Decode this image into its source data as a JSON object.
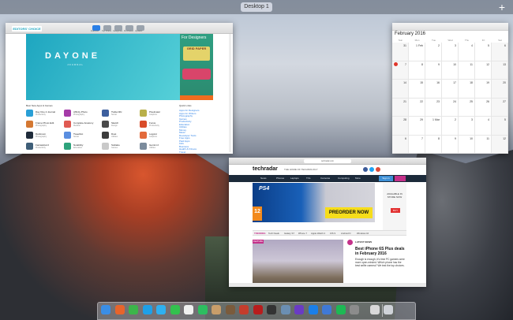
{
  "spaces_bar": {
    "desktop_label": "Desktop 1",
    "add_label": "+"
  },
  "app_store": {
    "tabs": [
      "Featured",
      "Top Charts",
      "Categories",
      "Purchased",
      "Updates"
    ],
    "hero": {
      "badge": "EDITORS' CHOICE",
      "title": "DAYONE",
      "subtitle": "JOURNAL"
    },
    "side": {
      "heading": "For Designers",
      "promo": "GRID PAPER"
    },
    "section_title": "Best New Apps & Games",
    "side_section_title": "Quick Links",
    "apps": [
      {
        "name": "Day One 2 Journal",
        "sub": "Productivity",
        "color": "#2a9fd6"
      },
      {
        "name": "Affinity Photo",
        "sub": "Photography",
        "color": "#a53ba8"
      },
      {
        "name": "Twitterrific",
        "sub": "Social",
        "color": "#3d5f9e"
      },
      {
        "name": "Pixelmator",
        "sub": "Graphics",
        "color": "#b9b04a"
      },
      {
        "name": "Frame Photo Edit",
        "sub": "Photography",
        "color": "#d47832"
      },
      {
        "name": "Complete Anatomy",
        "sub": "Medical",
        "color": "#e05a52"
      },
      {
        "name": "Sketch",
        "sub": "Design",
        "color": "#4a4a4a"
      },
      {
        "name": "Focus",
        "sub": "Productivity",
        "color": "#d94c2a"
      },
      {
        "name": "Darkroom",
        "sub": "Photography",
        "color": "#1f2b3a"
      },
      {
        "name": "Tweetbot",
        "sub": "Social",
        "color": "#5a8ee0"
      },
      {
        "name": "Duet",
        "sub": "Utilities",
        "color": "#3c3c3c"
      },
      {
        "name": "Logoist",
        "sub": "Graphics",
        "color": "#e36a3b"
      },
      {
        "name": "Fantastical 2",
        "sub": "Productivity",
        "color": "#3e5e78"
      },
      {
        "name": "Notability",
        "sub": "Education",
        "color": "#2ea37c"
      },
      {
        "name": "Solitaire",
        "sub": "Games",
        "color": "#c9c9c9"
      },
      {
        "name": "Gemini 2",
        "sub": "Utilities",
        "color": "#7b8b9c"
      }
    ],
    "paid_links": [
      "Apps for Designers",
      "Apps for Writers",
      "Photography",
      "Games",
      "Productivity",
      "Education",
      "Utilities",
      "Money",
      "Music",
      "Developer Tools",
      "Free Apps",
      "Paid Apps",
      "Kids",
      "Business",
      "Health & Fitness",
      "Travel",
      "Lifestyle",
      "Reference",
      "Weather",
      "News"
    ]
  },
  "calendar": {
    "title": "February 2016",
    "day_headers": [
      "Sun",
      "Mon",
      "Tue",
      "Wed",
      "Thu",
      "Fri",
      "Sat"
    ],
    "weeks": [
      [
        "31",
        "1 Feb",
        "2",
        "3",
        "4",
        "5",
        "6"
      ],
      [
        "7",
        "8",
        "9",
        "10",
        "11",
        "12",
        "13"
      ],
      [
        "14",
        "15",
        "16",
        "17",
        "18",
        "19",
        "20"
      ],
      [
        "21",
        "22",
        "23",
        "24",
        "25",
        "26",
        "27"
      ],
      [
        "28",
        "29",
        "1 Mar",
        "2",
        "3",
        "4",
        "5"
      ],
      [
        "6",
        "7",
        "8",
        "9",
        "10",
        "11",
        "12"
      ]
    ]
  },
  "browser": {
    "url": "techradar.com",
    "logo": "techradar",
    "tagline": "THE HOME OF TECHNOLOGY",
    "nav": [
      "News",
      "Phones",
      "Laptops",
      "TVs",
      "Cameras",
      "Computing",
      "More"
    ],
    "signin": "Sign in",
    "ad": {
      "brand": "PS4",
      "rating": "12",
      "cta": "PREORDER NOW"
    },
    "side_ad": {
      "text": "AVAILABLE IN STORE NOW",
      "btn": "BUY"
    },
    "tabs": [
      "TRENDING",
      "Tech Deals",
      "Galaxy S7",
      "iPhone 7",
      "Apple Watch 2",
      "iOS 9",
      "Android N",
      "Windows 10"
    ],
    "feature_badge": "FEATURE",
    "latest_label": "LATEST NEWS",
    "article_title": "Best iPhone 6S Plus deals in February 2016",
    "article_text": "Enough is enough, it's time PC gamers were more open-minded. Which phone has the best selfie camera? We test the top choices."
  },
  "dock": {
    "icons": [
      {
        "name": "finder",
        "color": "#3a8ee6"
      },
      {
        "name": "firefox",
        "color": "#e8642b"
      },
      {
        "name": "facetime",
        "color": "#3cb54a"
      },
      {
        "name": "skype",
        "color": "#1ea0e8"
      },
      {
        "name": "messages",
        "color": "#2fb0f0"
      },
      {
        "name": "whatsapp",
        "color": "#33c14e"
      },
      {
        "name": "calendar",
        "color": "#f0f0f0"
      },
      {
        "name": "evernote",
        "color": "#2dbe60"
      },
      {
        "name": "contacts",
        "color": "#c89e6a"
      },
      {
        "name": "archive",
        "color": "#7a5b3c"
      },
      {
        "name": "cyberduck",
        "color": "#c43d2c"
      },
      {
        "name": "filezilla",
        "color": "#b81d1d"
      },
      {
        "name": "terminal",
        "color": "#333333"
      },
      {
        "name": "preview",
        "color": "#6b8fb3"
      },
      {
        "name": "imovie",
        "color": "#6a3bc4"
      },
      {
        "name": "app-store",
        "color": "#1a7fe8"
      },
      {
        "name": "xcode",
        "color": "#3f79d6"
      },
      {
        "name": "spotify",
        "color": "#1db954"
      },
      {
        "name": "system-preferences",
        "color": "#8c8c8c"
      },
      {
        "name": "documents",
        "color": "#d8d8d8"
      },
      {
        "name": "trash",
        "color": "#cfd3d8"
      }
    ]
  }
}
